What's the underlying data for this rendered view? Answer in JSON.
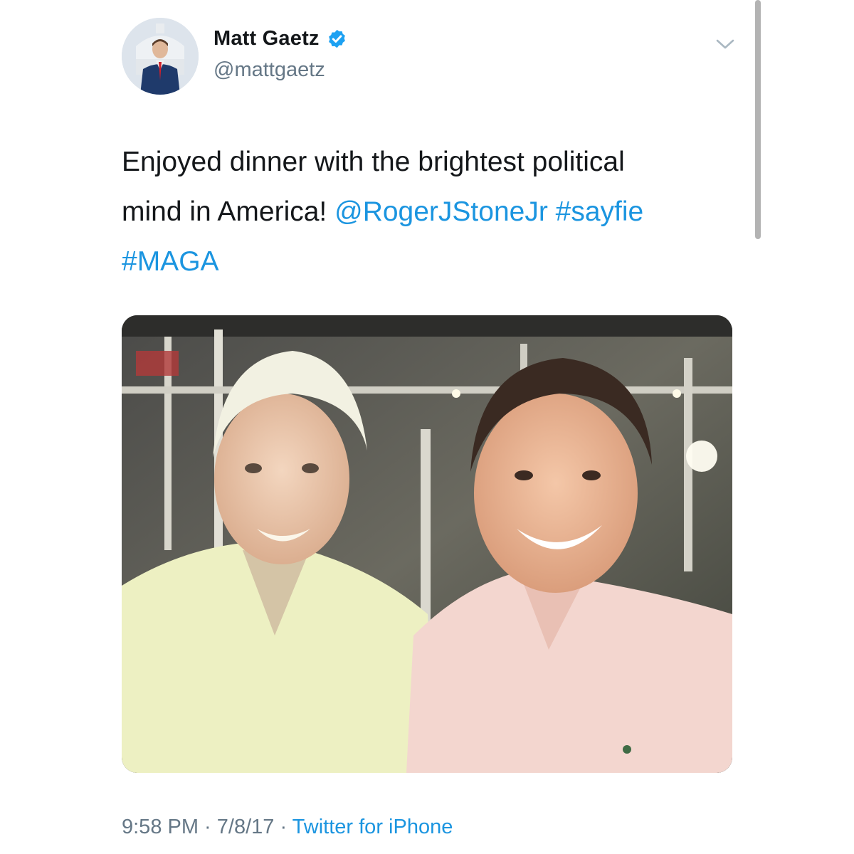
{
  "user": {
    "display_name": "Matt Gaetz",
    "handle": "@mattgaetz",
    "verified": true
  },
  "icons": {
    "verified": "verified-badge-icon",
    "menu": "chevron-down-icon"
  },
  "tweet": {
    "text_plain_1": "Enjoyed dinner with the brightest political",
    "text_plain_2": "mind in America! ",
    "mention": "@RogerJStoneJr",
    "space": " ",
    "hashtag_1": "#sayfie",
    "hashtag_2": "#MAGA"
  },
  "meta": {
    "time": "9:58 PM",
    "sep_1": " · ",
    "date": "7/8/17",
    "sep_2": " · ",
    "source": "Twitter for iPhone"
  },
  "colors": {
    "link": "#1b95e0",
    "text": "#14171a",
    "secondary": "#657786",
    "verified": "#1da1f2"
  }
}
